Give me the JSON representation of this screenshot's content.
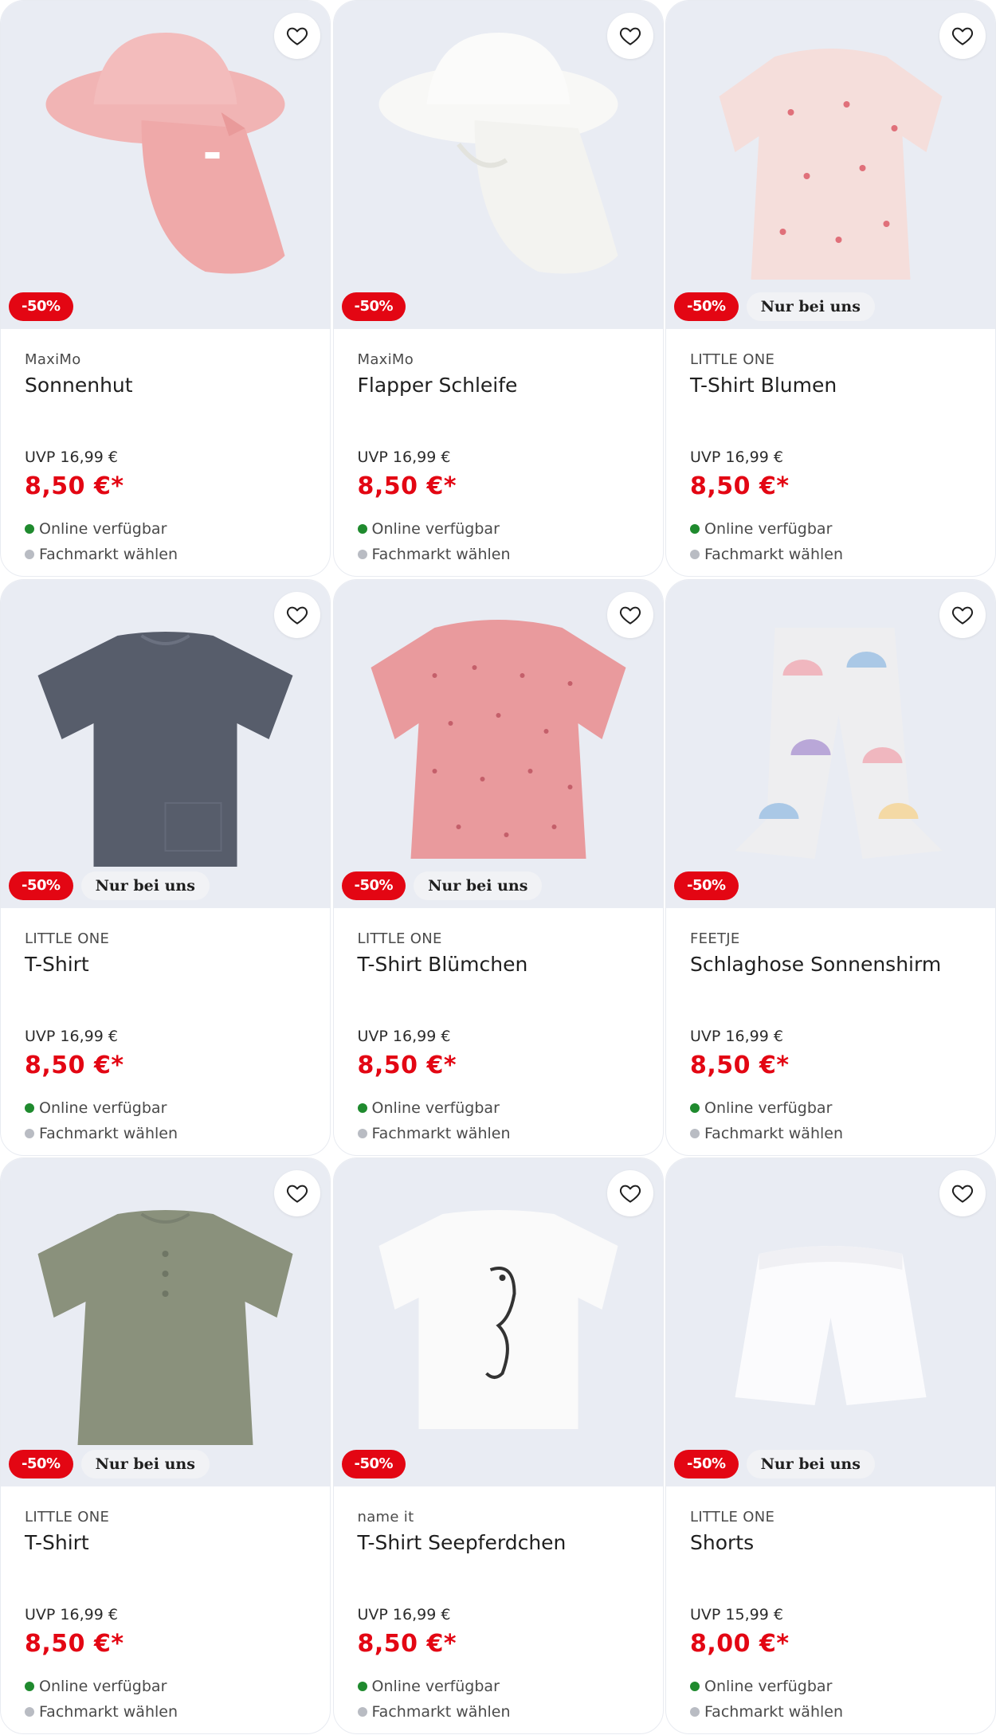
{
  "colors": {
    "sale_red": "#e30613",
    "available_green": "#1f8a2e",
    "store_grey": "#b9bcc3",
    "image_bg": "#e9ecf3"
  },
  "products": [
    {
      "brand": "MaxiMo",
      "title": "Sonnenhut",
      "uvp": "UVP 16,99 €",
      "price": "8,50 €*",
      "discount": "-50%",
      "exclusive": "",
      "online": "Online verfügbar",
      "store": "Fachmarkt wählen",
      "image": "pink-sun-hat"
    },
    {
      "brand": "MaxiMo",
      "title": "Flapper Schleife",
      "uvp": "UVP 16,99 €",
      "price": "8,50 €*",
      "discount": "-50%",
      "exclusive": "",
      "online": "Online verfügbar",
      "store": "Fachmarkt wählen",
      "image": "white-sun-hat"
    },
    {
      "brand": "LITTLE ONE",
      "title": "T-Shirt Blumen",
      "uvp": "UVP 16,99 €",
      "price": "8,50 €*",
      "discount": "-50%",
      "exclusive": "Nur bei uns",
      "online": "Online verfügbar",
      "store": "Fachmarkt wählen",
      "image": "light-pink-blouse"
    },
    {
      "brand": "LITTLE ONE",
      "title": "T-Shirt",
      "uvp": "UVP 16,99 €",
      "price": "8,50 €*",
      "discount": "-50%",
      "exclusive": "Nur bei uns",
      "online": "Online verfügbar",
      "store": "Fachmarkt wählen",
      "image": "navy-tshirt"
    },
    {
      "brand": "LITTLE ONE",
      "title": "T-Shirt Blümchen",
      "uvp": "UVP 16,99 €",
      "price": "8,50 €*",
      "discount": "-50%",
      "exclusive": "Nur bei uns",
      "online": "Online verfügbar",
      "store": "Fachmarkt wählen",
      "image": "pink-floral-blouse"
    },
    {
      "brand": "FEETJE",
      "title": "Schlaghose Sonnenshirm",
      "uvp": "UVP 16,99 €",
      "price": "8,50 €*",
      "discount": "-50%",
      "exclusive": "",
      "online": "Online verfügbar",
      "store": "Fachmarkt wählen",
      "image": "umbrella-print-pants"
    },
    {
      "brand": "LITTLE ONE",
      "title": "T-Shirt",
      "uvp": "UVP 16,99 €",
      "price": "8,50 €*",
      "discount": "-50%",
      "exclusive": "Nur bei uns",
      "online": "Online verfügbar",
      "store": "Fachmarkt wählen",
      "image": "olive-tshirt"
    },
    {
      "brand": "name it",
      "title": "T-Shirt Seepferdchen",
      "uvp": "UVP 16,99 €",
      "price": "8,50 €*",
      "discount": "-50%",
      "exclusive": "",
      "online": "Online verfügbar",
      "store": "Fachmarkt wählen",
      "image": "seahorse-tshirt"
    },
    {
      "brand": "LITTLE ONE",
      "title": "Shorts",
      "uvp": "UVP 15,99 €",
      "price": "8,00 €*",
      "discount": "-50%",
      "exclusive": "Nur bei uns",
      "online": "Online verfügbar",
      "store": "Fachmarkt wählen",
      "image": "white-shorts"
    }
  ]
}
